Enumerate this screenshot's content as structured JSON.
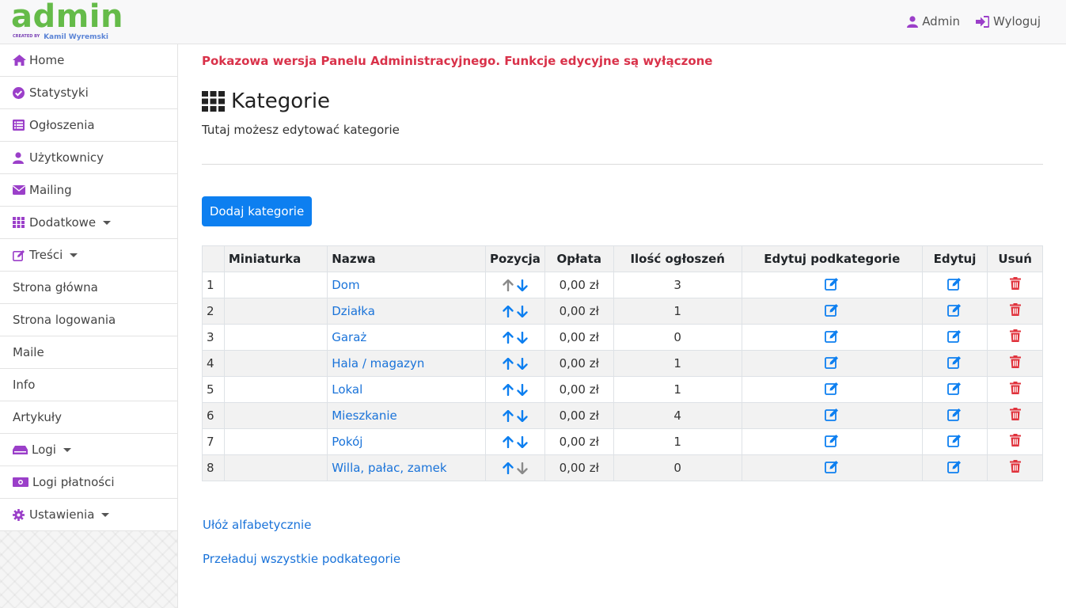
{
  "logo": {
    "main": "admin",
    "created_by": "CREATED BY",
    "author": "Kamil Wyremski"
  },
  "header": {
    "user_label": "Admin",
    "logout_label": "Wyloguj"
  },
  "sidebar": {
    "items": [
      {
        "label": "Home",
        "icon": "home-icon"
      },
      {
        "label": "Statystyki",
        "icon": "check-circle-icon"
      },
      {
        "label": "Ogłoszenia",
        "icon": "list-icon"
      },
      {
        "label": "Użytkownicy",
        "icon": "user-icon"
      },
      {
        "label": "Mailing",
        "icon": "envelope-icon"
      },
      {
        "label": "Dodatkowe",
        "icon": "grid-icon",
        "dropdown": true
      },
      {
        "label": "Treści",
        "icon": "edit-icon",
        "dropdown": true
      },
      {
        "label": "Strona główna"
      },
      {
        "label": "Strona logowania"
      },
      {
        "label": "Maile"
      },
      {
        "label": "Info"
      },
      {
        "label": "Artykuły"
      },
      {
        "label": "Logi",
        "icon": "hdd-icon",
        "dropdown": true
      },
      {
        "label": "Logi płatności",
        "icon": "money-icon"
      },
      {
        "label": "Ustawienia",
        "icon": "gear-icon",
        "dropdown": true
      }
    ]
  },
  "notice": "Pokazowa wersja Panelu Administracyjnego. Funkcje edycyjne są wyłączone",
  "page": {
    "title": "Kategorie",
    "subtitle": "Tutaj możesz edytować kategorie",
    "add_button": "Dodaj kategorie"
  },
  "table": {
    "headers": [
      "",
      "Miniaturka",
      "Nazwa",
      "Pozycja",
      "Opłata",
      "Ilość ogłoszeń",
      "Edytuj podkategorie",
      "Edytuj",
      "Usuń"
    ],
    "rows": [
      {
        "num": "1",
        "name": "Dom",
        "fee": "0,00 zł",
        "count": "3",
        "up_enabled": false,
        "down_enabled": true
      },
      {
        "num": "2",
        "name": "Działka",
        "fee": "0,00 zł",
        "count": "1",
        "up_enabled": true,
        "down_enabled": true
      },
      {
        "num": "3",
        "name": "Garaż",
        "fee": "0,00 zł",
        "count": "0",
        "up_enabled": true,
        "down_enabled": true
      },
      {
        "num": "4",
        "name": "Hala / magazyn",
        "fee": "0,00 zł",
        "count": "1",
        "up_enabled": true,
        "down_enabled": true
      },
      {
        "num": "5",
        "name": "Lokal",
        "fee": "0,00 zł",
        "count": "1",
        "up_enabled": true,
        "down_enabled": true
      },
      {
        "num": "6",
        "name": "Mieszkanie",
        "fee": "0,00 zł",
        "count": "4",
        "up_enabled": true,
        "down_enabled": true
      },
      {
        "num": "7",
        "name": "Pokój",
        "fee": "0,00 zł",
        "count": "1",
        "up_enabled": true,
        "down_enabled": true
      },
      {
        "num": "8",
        "name": "Willa, pałac, zamek",
        "fee": "0,00 zł",
        "count": "0",
        "up_enabled": true,
        "down_enabled": false
      }
    ]
  },
  "links": {
    "sort_alpha": "Ułóż alfabetycznie",
    "reload_sub": "Przeładuj wszystkie podkategorie"
  },
  "colors": {
    "accent": "#0d7ff0",
    "brand_green": "#65bb49",
    "icon_purple": "#9b3fc9",
    "notice_red": "#d9324a",
    "delete_red": "#e0323c",
    "arrow_disabled": "#8a8a8a"
  }
}
